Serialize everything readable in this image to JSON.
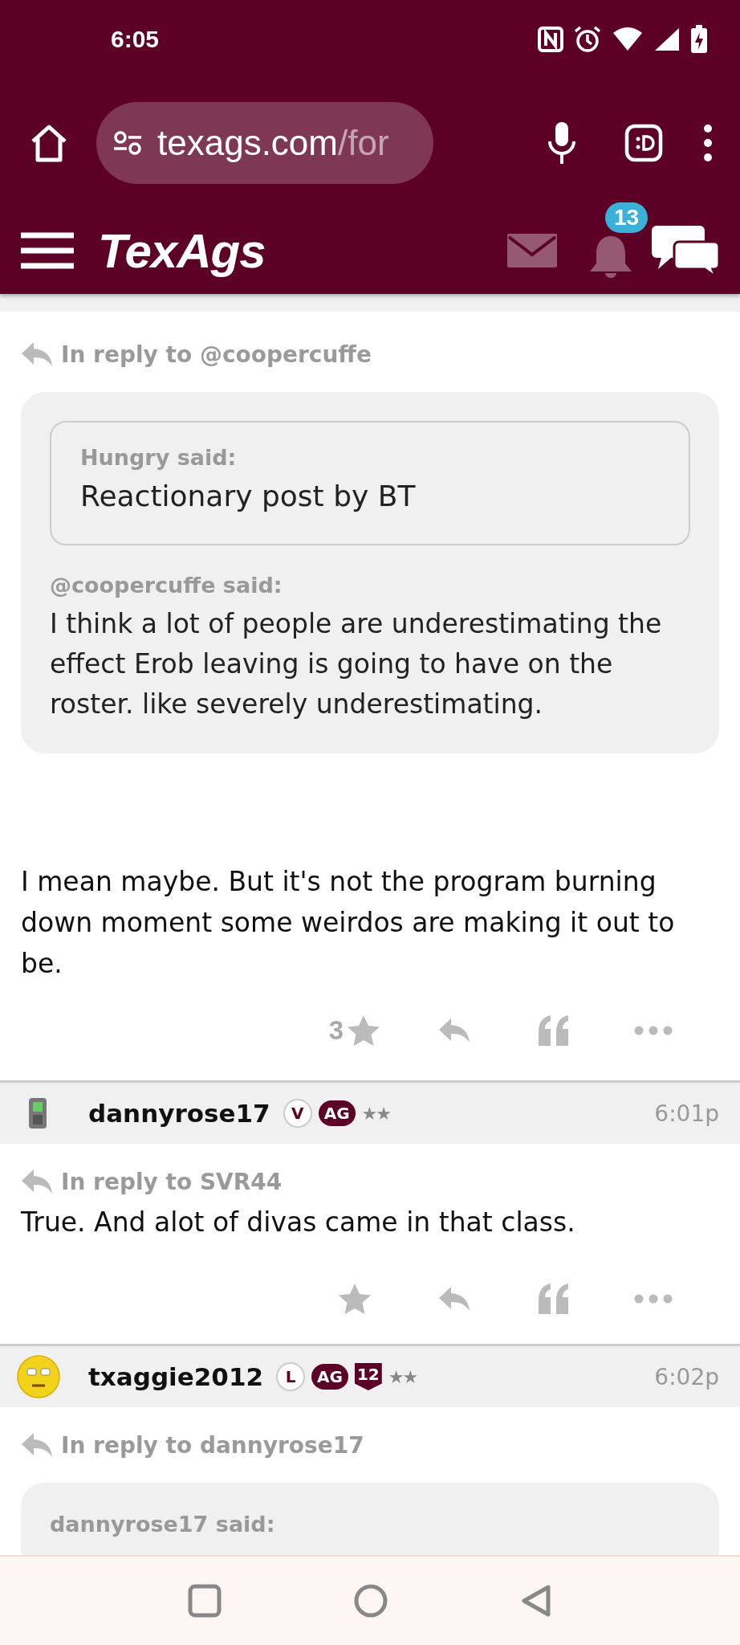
{
  "status_bar": {
    "time": "6:05"
  },
  "browser": {
    "url_host": "texags.com",
    "url_rest": "/for"
  },
  "site_header": {
    "logo": "TexAgs",
    "notification_count": "13"
  },
  "posts": [
    {
      "kind": "tail",
      "reply_to": "In reply to @coopercuffe",
      "quote": {
        "nested": {
          "author": "Hungry said:",
          "text": "Reactionary post by BT"
        },
        "author": "@coopercuffe said:",
        "text": "I think a lot of people are underestimating the effect Erob leaving is going to have on the roster. like severely underestimating."
      },
      "body": "I mean maybe. But it's not the program burning down moment some weirdos are making it out to be.",
      "star_count": "3"
    },
    {
      "kind": "full",
      "user": {
        "name": "dannyrose17",
        "avatar": {
          "kind": "phone"
        },
        "badges": [
          {
            "kind": "circle",
            "text": "V"
          },
          {
            "kind": "pill",
            "text": "AG"
          }
        ],
        "rank": "★★"
      },
      "time": "6:01p",
      "reply_to": "In reply to SVR44",
      "body": "True. And alot of divas came in that class."
    },
    {
      "kind": "full",
      "user": {
        "name": "txaggie2012",
        "avatar": {
          "kind": "smiley"
        },
        "badges": [
          {
            "kind": "circle",
            "text": "L"
          },
          {
            "kind": "pill",
            "text": "AG"
          },
          {
            "kind": "shield",
            "text": "12"
          }
        ],
        "rank": "★★"
      },
      "time": "6:02p",
      "reply_to": "In reply to dannyrose17",
      "quote": {
        "author": "dannyrose17 said:"
      }
    }
  ]
}
